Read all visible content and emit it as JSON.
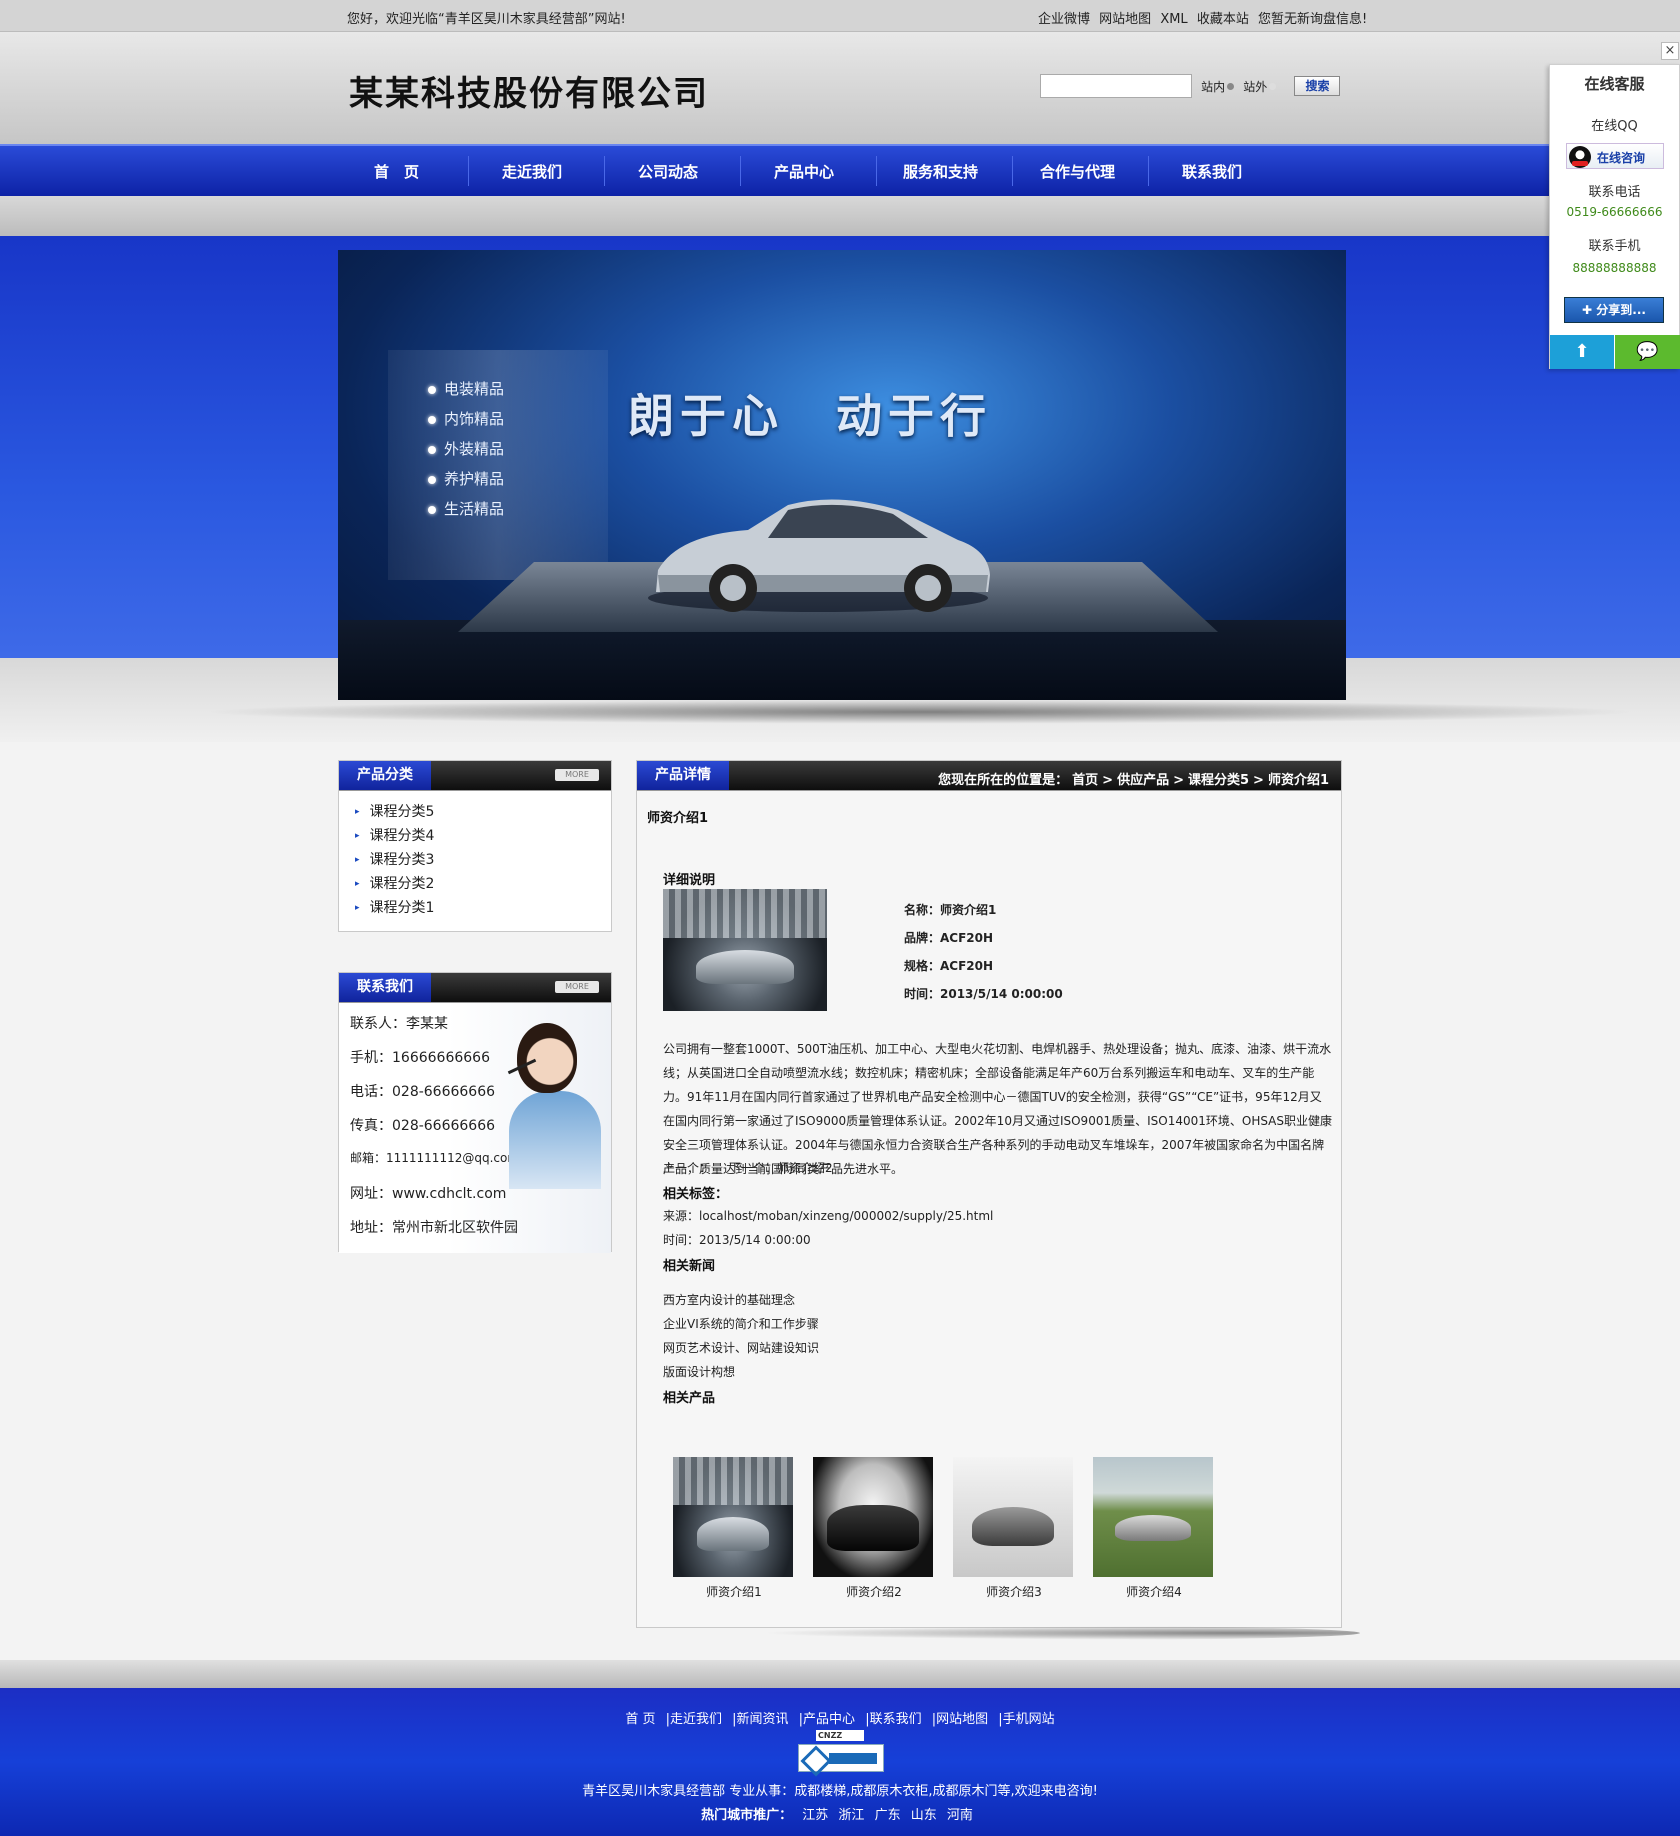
{
  "topbar": {
    "welcome": "您好，欢迎光临“青羊区昊川木家具经营部”网站!",
    "links": [
      "企业微博",
      "网站地图",
      "XML",
      "收藏本站",
      "您暂无新询盘信息!"
    ]
  },
  "header": {
    "logo": "某某科技股份有限公司",
    "search": {
      "placeholder": "",
      "opt_in": "站内",
      "opt_out": "站外",
      "button": "搜索"
    }
  },
  "nav": [
    "首　页",
    "走近我们",
    "公司动态",
    "产品中心",
    "服务和支持",
    "合作与代理",
    "联系我们"
  ],
  "banner": {
    "menu": [
      "电装精品",
      "内饰精品",
      "外装精品",
      "养护精品",
      "生活精品"
    ],
    "slogan": "朗于心　动于行"
  },
  "category_box": {
    "title": "产品分类",
    "more": "MORE",
    "items": [
      "课程分类5",
      "课程分类4",
      "课程分类3",
      "课程分类2",
      "课程分类1"
    ]
  },
  "contact_box": {
    "title": "联系我们",
    "more": "MORE",
    "rows": [
      "联系人：李某某",
      "手机：16666666666",
      "电话：028-66666666",
      "传真：028-66666666",
      "邮箱：1111111112@qq.com",
      "网址：www.cdhclt.com",
      "地址：常州市新北区软件园"
    ]
  },
  "detail": {
    "tab": "产品详情",
    "breadcrumb": {
      "prefix": "您现在所在的位置是：",
      "items": [
        "首页",
        "供应产品",
        "课程分类5",
        "师资介绍1"
      ],
      "sep": ">"
    },
    "product_title": "师资介绍1",
    "section_title": "详细说明",
    "specs": [
      "名称：师资介绍1",
      "品牌：ACF20H",
      "规格：ACF20H",
      "时间：2013/5/14 0:00:00"
    ],
    "description": "公司拥有一整套1000T、500T油压机、加工中心、大型电火花切割、电焊机器手、热处理设备；抛丸、底漆、油漆、烘干流水线；从英国进口全自动喷塑流水线；数控机床；精密机床；全部设备能满足年产60万台系列搬运车和电动车、叉车的生产能力。91年11月在国内同行首家通过了世界机电产品安全检测中心－德国TUV的安全检测，获得“GS”“CE”证书，95年12月又在国内同行第一家通过了ISO9000质量管理体系认证。2002年10月又通过ISO9001质量、ISO14001环境、OHSAS职业健康安全三项管理体系认证。2004年与德国永恒力合资联合生产各种系列的手动电动叉车堆垛车，2007年被国家命名为中国名牌产品，质量达到当前国际同类产品先进水平。",
    "prev_next": "上一个：　　下一个：师资介绍2",
    "tags_label": "相关标签：",
    "source": "来源：localhost/moban/xinzeng/000002/supply/25.html",
    "time": "时间：2013/5/14 0:00:00",
    "related_news_title": "相关新闻",
    "related_news": [
      "西方室内设计的基础理念",
      "企业VI系统的简介和工作步骤",
      "网页艺术设计、网站建设知识",
      "版面设计构想"
    ],
    "related_products_title": "相关产品",
    "related_products": [
      "师资介绍1",
      "师资介绍2",
      "师资介绍3",
      "师资介绍4"
    ]
  },
  "footer": {
    "links": [
      "首 页",
      "|走近我们",
      "|新闻资讯",
      "|产品中心",
      "|联系我们",
      "|网站地图",
      "|手机网站"
    ],
    "cnzz": "CNZZ",
    "intro": "青羊区昊川木家具经营部 专业从事：成都楼梯,成都原木衣柜,成都原木门等,欢迎来电咨询!",
    "hot_label": "热门城市推广：",
    "cities": [
      "江苏",
      "浙江",
      "广东",
      "山东",
      "河南"
    ]
  },
  "float_service": {
    "close": "×",
    "title": "在线客服",
    "qq_label": "在线QQ",
    "qq_button": "在线咨询",
    "phone_label": "联系电话",
    "phone": "0519-66666666",
    "mobile_label": "联系手机",
    "mobile": "88888888888",
    "share": "✚ 分享到..."
  }
}
